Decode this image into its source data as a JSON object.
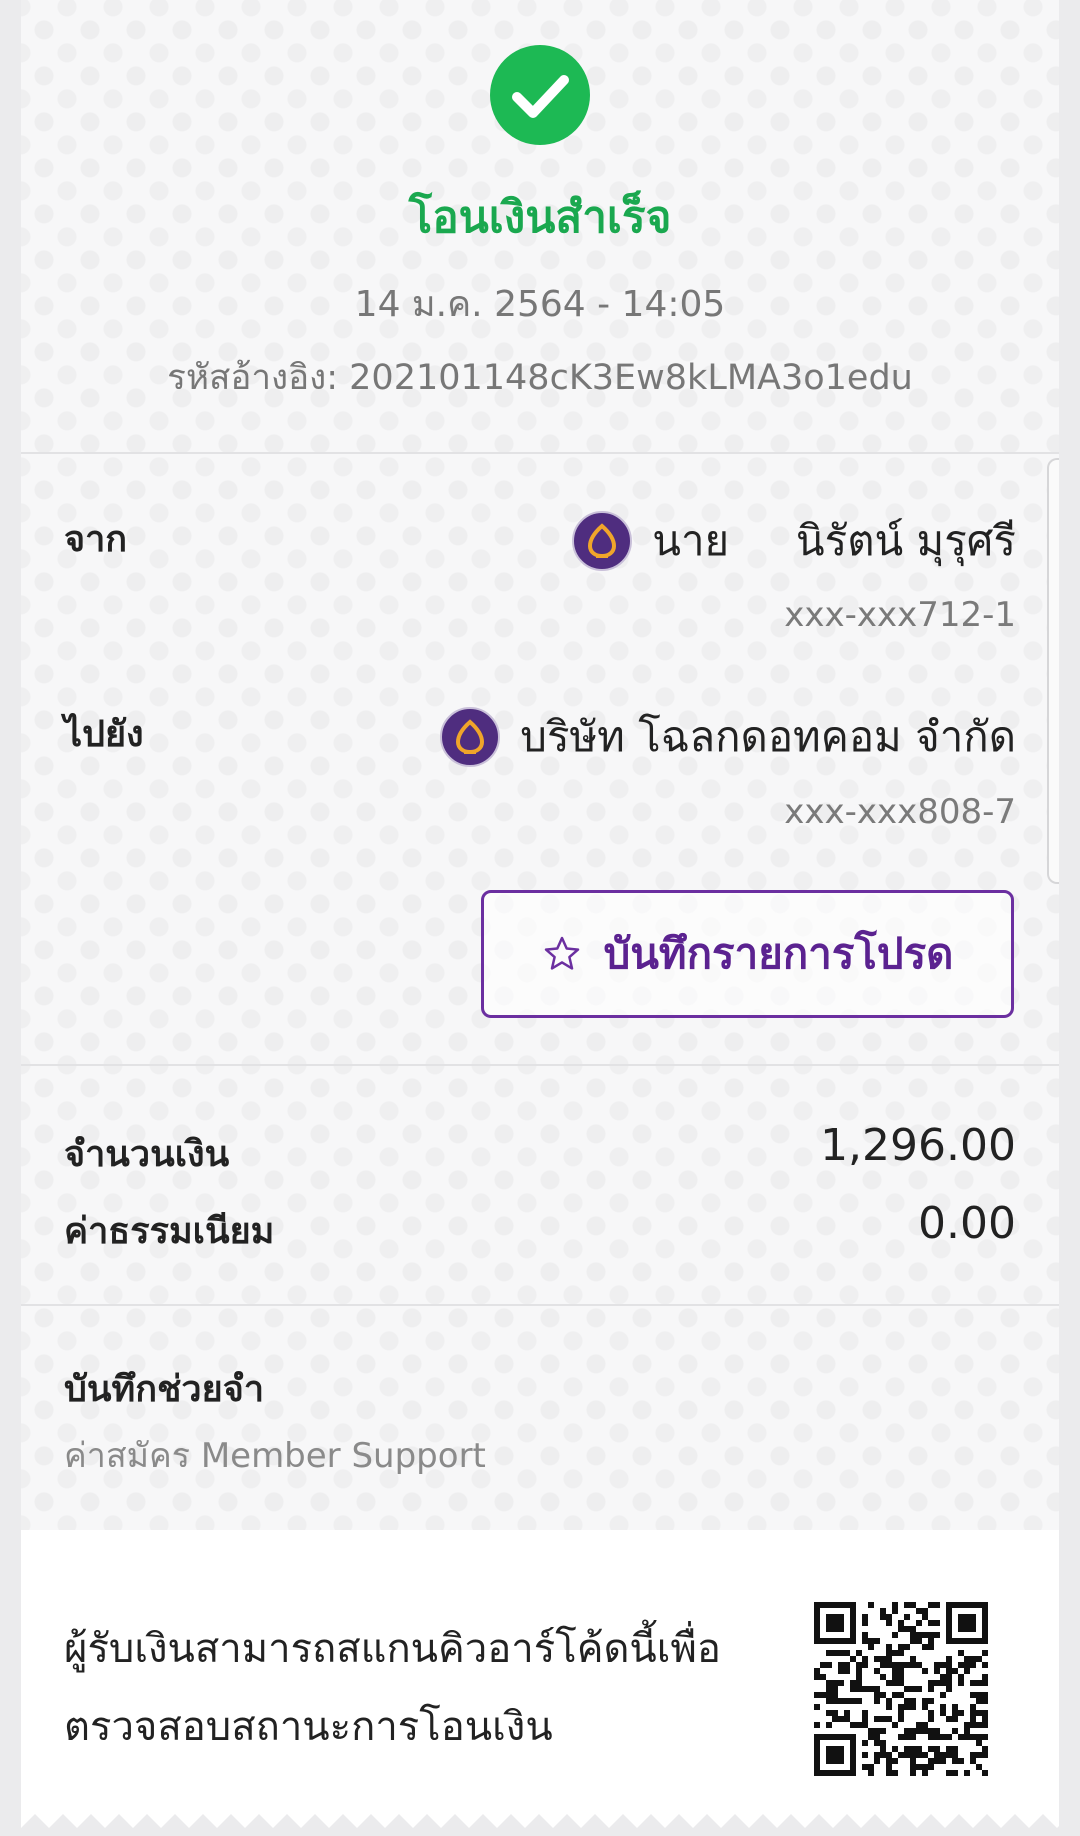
{
  "status": {
    "title": "โอนเงินสำเร็จ",
    "datetime": "14 ม.ค. 2564 - 14:05",
    "reference": "รหัสอ้างอิง: 202101148cK3Ew8kLMA3o1edu",
    "success_color": "#1db954"
  },
  "from": {
    "label": "จาก",
    "name": "นาย     นิรัตน์ มุรุศรี",
    "account": "xxx-xxx712-1",
    "bank_icon": "bank-logo-icon"
  },
  "to": {
    "label": "ไปยัง",
    "name": "บริษัท โฉลกดอทคอม จำกัด",
    "account": "xxx-xxx808-7",
    "bank_icon": "bank-logo-icon"
  },
  "favorite_button": {
    "label": "บันทึกรายการโปรด",
    "icon": "star-outline-icon",
    "accent_color": "#6b2fa0"
  },
  "amounts": {
    "amount_label": "จำนวนเงิน",
    "amount_value": "1,296.00",
    "fee_label": "ค่าธรรมเนียม",
    "fee_value": "0.00"
  },
  "memo": {
    "title": "บันทึกช่วยจำ",
    "text": "ค่าสมัคร Member Support"
  },
  "qr": {
    "text_line1": "ผู้รับเงินสามารถสแกนคิวอาร์โค้ดนี้เพื่อ",
    "text_line2": "ตรวจสอบสถานะการโอนเงิน",
    "icon": "qr-code-icon"
  }
}
